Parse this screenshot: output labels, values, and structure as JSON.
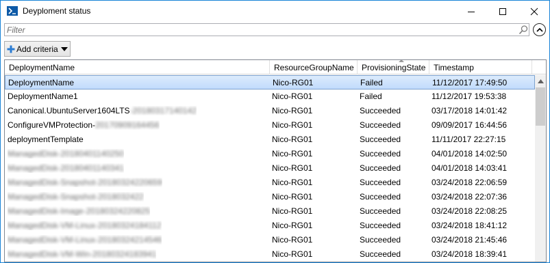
{
  "window": {
    "title": "Deyploment status",
    "icon": "powershell-icon"
  },
  "filter": {
    "placeholder": "Filter"
  },
  "toolbar": {
    "add_criteria_label": "Add criteria"
  },
  "columns": [
    "DeploymentName",
    "ResourceGroupName",
    "ProvisioningState",
    "Timestamp"
  ],
  "rows": [
    {
      "name": "DeploymentName",
      "name_suffix": "",
      "group": "Nico-RG01",
      "state": "Failed",
      "timestamp": "11/12/2017 17:49:50",
      "selected": true
    },
    {
      "name": "DeploymentName1",
      "name_suffix": "",
      "group": "Nico-RG01",
      "state": "Failed",
      "timestamp": "11/12/2017 19:53:38",
      "selected": false
    },
    {
      "name": "Canonical.UbuntuServer1604LTS",
      "name_suffix": "-20180317140142",
      "group": "Nico-RG01",
      "state": "Succeeded",
      "timestamp": "03/17/2018 14:01:42",
      "selected": false
    },
    {
      "name": "ConfigureVMProtection-",
      "name_suffix": "20170909164456",
      "group": "Nico-RG01",
      "state": "Succeeded",
      "timestamp": "09/09/2017 16:44:56",
      "selected": false
    },
    {
      "name": "deploymentTemplate",
      "name_suffix": "",
      "group": "Nico-RG01",
      "state": "Succeeded",
      "timestamp": "11/11/2017 22:27:15",
      "selected": false
    },
    {
      "name": "",
      "name_suffix": "ManagedDisk-20180401140250",
      "group": "Nico-RG01",
      "state": "Succeeded",
      "timestamp": "04/01/2018 14:02:50",
      "selected": false
    },
    {
      "name": "",
      "name_suffix": "ManagedDisk-20180401140341",
      "group": "Nico-RG01",
      "state": "Succeeded",
      "timestamp": "04/01/2018 14:03:41",
      "selected": false
    },
    {
      "name": "",
      "name_suffix": "ManagedDisk-Snapshot-20180324220659",
      "group": "Nico-RG01",
      "state": "Succeeded",
      "timestamp": "03/24/2018 22:06:59",
      "selected": false
    },
    {
      "name": "",
      "name_suffix": "ManagedDisk-Snapshot-2018032422",
      "group": "Nico-RG01",
      "state": "Succeeded",
      "timestamp": "03/24/2018 22:07:36",
      "selected": false
    },
    {
      "name": "",
      "name_suffix": "ManagedDisk-Image-20180324220825",
      "group": "Nico-RG01",
      "state": "Succeeded",
      "timestamp": "03/24/2018 22:08:25",
      "selected": false
    },
    {
      "name": "",
      "name_suffix": "ManagedDisk-VM-Linux-20180324184112",
      "group": "Nico-RG01",
      "state": "Succeeded",
      "timestamp": "03/24/2018 18:41:12",
      "selected": false
    },
    {
      "name": "",
      "name_suffix": "ManagedDisk-VM-Linux-20180324214546",
      "group": "Nico-RG01",
      "state": "Succeeded",
      "timestamp": "03/24/2018 21:45:46",
      "selected": false
    },
    {
      "name": "",
      "name_suffix": "ManagedDisk-VM-Win-20180324183941",
      "group": "Nico-RG01",
      "state": "Succeeded",
      "timestamp": "03/24/2018 18:39:41",
      "selected": false
    }
  ],
  "colors": {
    "accent": "#1883d7",
    "selection_fill": "#cce4fb",
    "selection_border": "#7da2ce"
  }
}
